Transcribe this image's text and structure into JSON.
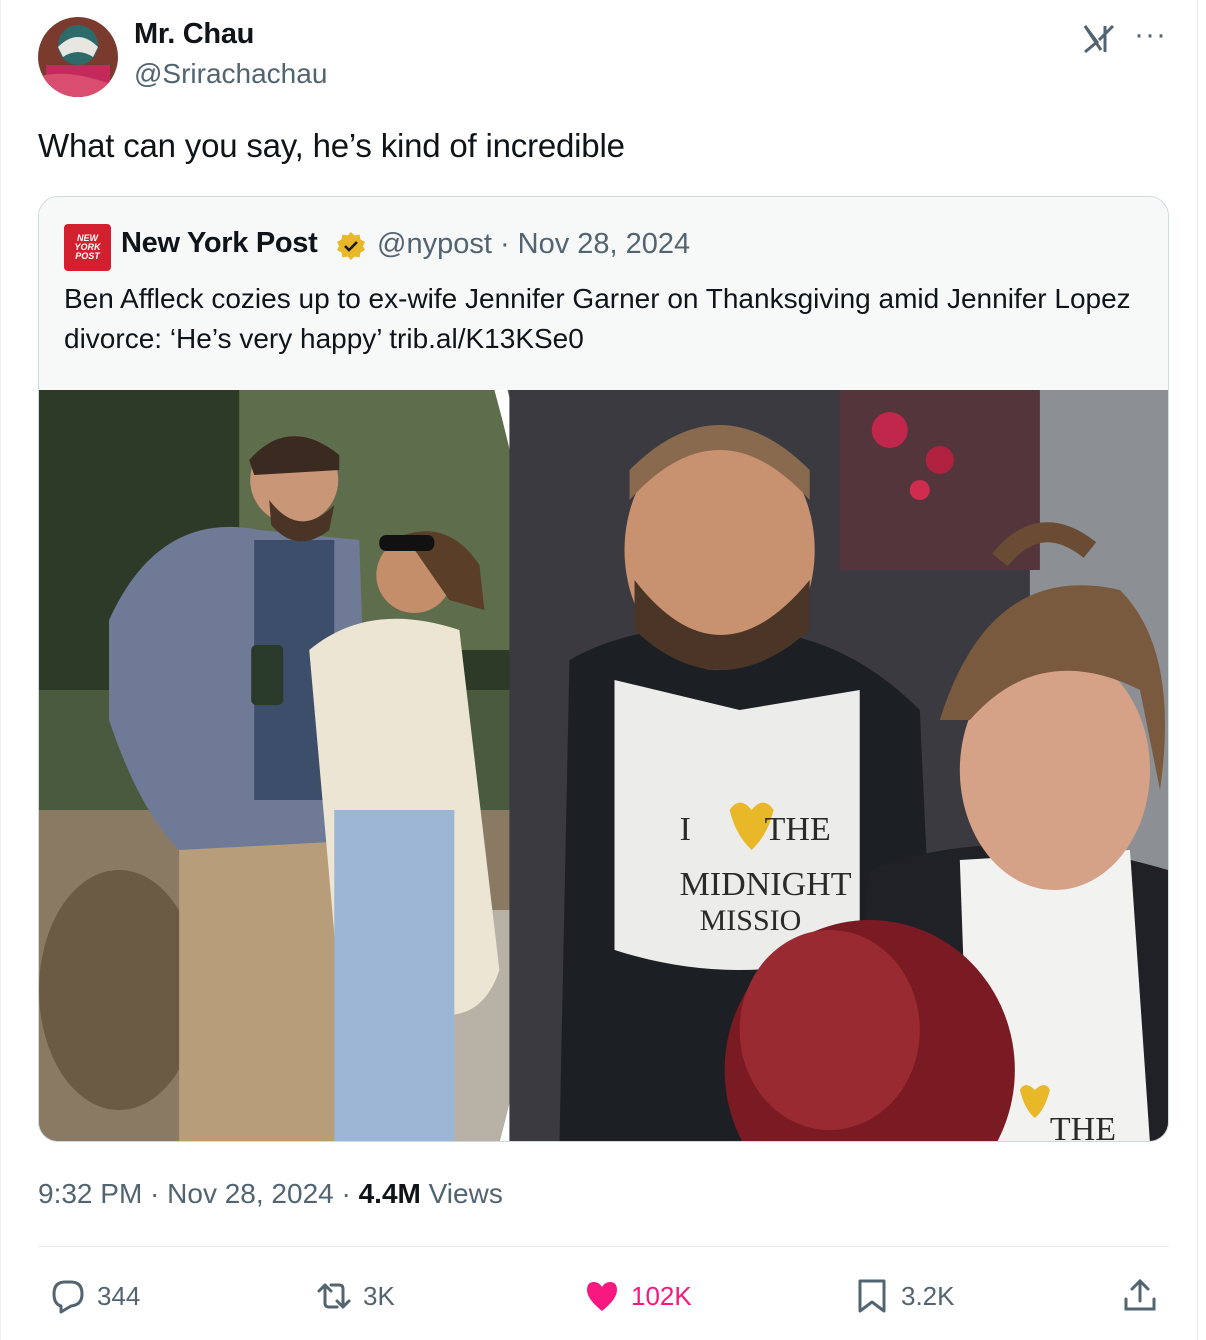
{
  "author": {
    "name": "Mr. Chau",
    "handle": "@Srirachachau"
  },
  "tweet_text": "What can you say, he’s kind of incredible",
  "quoted": {
    "logo_text": [
      "NEW",
      "YORK",
      "POST"
    ],
    "name": "New York Post",
    "meta": "@nypost · Nov 28, 2024",
    "text": "Ben Affleck cozies up to ex-wife Jennifer Garner on Thanksgiving amid Jennifer Lopez divorce: ‘He’s very happy’ trib.al/K13KSe0",
    "image": {
      "apron_text": [
        "I",
        "THE",
        "MIDNIGHT",
        "MISSIO"
      ],
      "apron_text_right": "THE"
    }
  },
  "footer": {
    "time": "9:32 PM · Nov 28, 2024 · ",
    "views_count": "4.4M",
    "views_label": " Views"
  },
  "actions": {
    "replies": "344",
    "reposts": "3K",
    "likes": "102K",
    "bookmarks": "3.2K"
  },
  "colors": {
    "like_pink": "#f91880",
    "secondary_text": "#536471",
    "nyp_red": "#d2202f",
    "verified_gold": "#e8b829"
  },
  "icons": [
    "x-logo-icon",
    "more-icon",
    "verified-badge-icon",
    "reply-icon",
    "repost-icon",
    "like-icon",
    "bookmark-icon",
    "share-icon"
  ]
}
